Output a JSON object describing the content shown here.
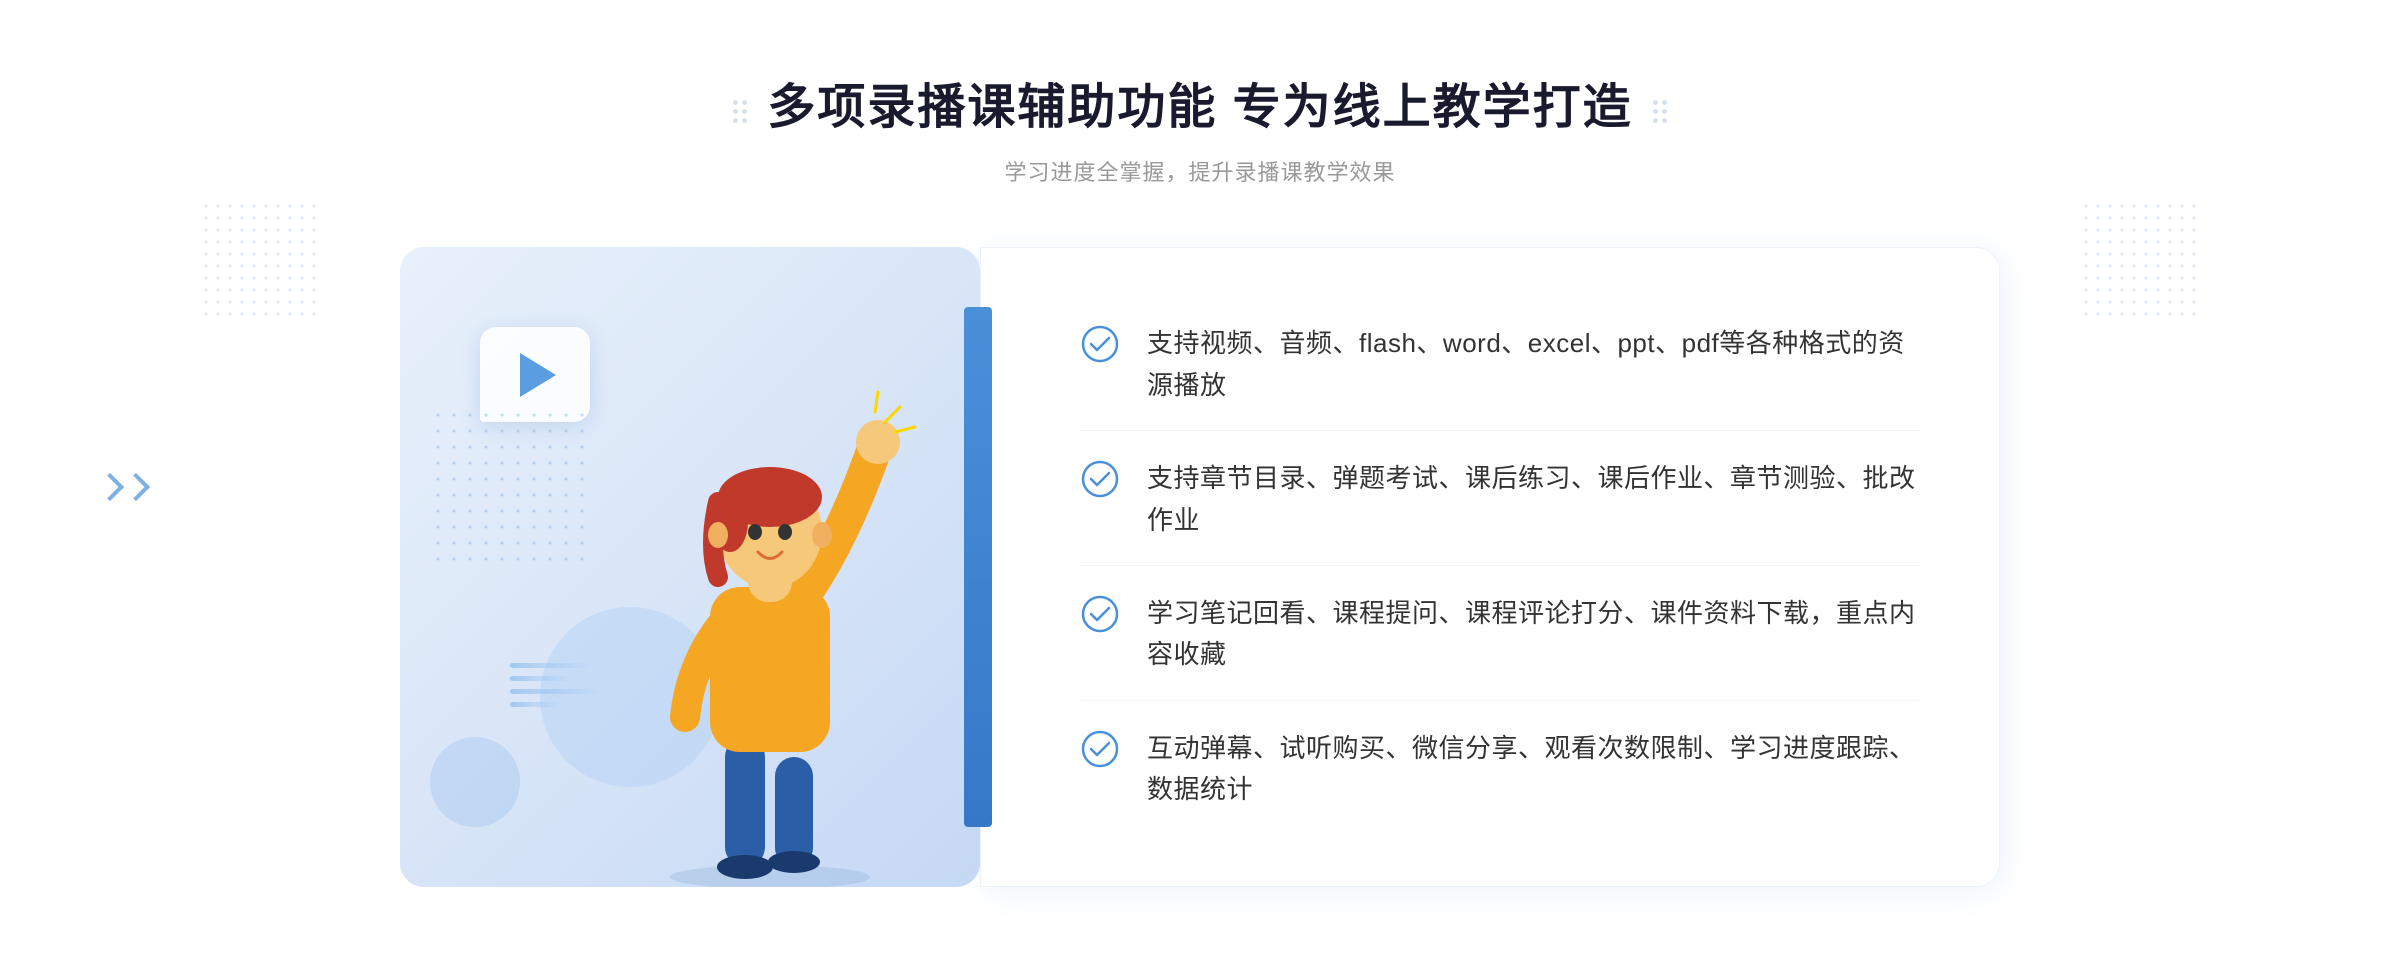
{
  "header": {
    "title": "多项录播课辅助功能 专为线上教学打造",
    "subtitle": "学习进度全掌握，提升录播课教学效果"
  },
  "features": [
    {
      "id": "feature-1",
      "text": "支持视频、音频、flash、word、excel、ppt、pdf等各种格式的资源播放"
    },
    {
      "id": "feature-2",
      "text": "支持章节目录、弹题考试、课后练习、课后作业、章节测验、批改作业"
    },
    {
      "id": "feature-3",
      "text": "学习笔记回看、课程提问、课程评论打分、课件资料下载，重点内容收藏"
    },
    {
      "id": "feature-4",
      "text": "互动弹幕、试听购买、微信分享、观看次数限制、学习进度跟踪、数据统计"
    }
  ],
  "icons": {
    "check": "✓",
    "play": "▶"
  },
  "colors": {
    "primary": "#4a90d9",
    "title": "#1a1a2e",
    "subtitle": "#999999",
    "feature_text": "#333333",
    "check_color": "#4a90d9"
  }
}
